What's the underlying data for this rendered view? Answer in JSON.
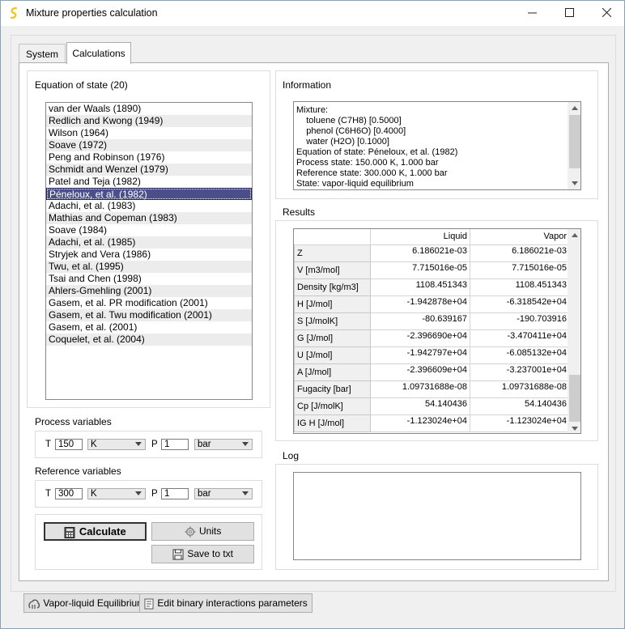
{
  "window": {
    "title": "Mixture properties calculation",
    "minimize": "—",
    "maximize": "☐",
    "close": "✕"
  },
  "tabs": [
    {
      "label": "System",
      "active": false
    },
    {
      "label": "Calculations",
      "active": true
    }
  ],
  "eos": {
    "group_label": "Equation of state (20)",
    "items": [
      "van der Waals (1890)",
      "Redlich and Kwong (1949)",
      "Wilson (1964)",
      "Soave (1972)",
      "Peng and Robinson (1976)",
      "Schmidt and Wenzel (1979)",
      "Patel and Teja (1982)",
      "Péneloux, et al. (1982)",
      "Adachi, et al. (1983)",
      "Mathias and Copeman (1983)",
      "Soave (1984)",
      "Adachi, et al. (1985)",
      "Stryjek and Vera (1986)",
      "Twu, et al. (1995)",
      "Tsai and Chen (1998)",
      "Ahlers-Gmehling (2001)",
      "Gasem, et al. PR modification (2001)",
      "Gasem, et al. Twu modification (2001)",
      "Gasem, et al. (2001)",
      "Coquelet, et al. (2004)"
    ],
    "selected_index": 7
  },
  "process": {
    "group_label": "Process variables",
    "t_label": "T",
    "t_value": "150",
    "t_unit": "K",
    "p_label": "P",
    "p_value": "1",
    "p_unit": "bar"
  },
  "reference": {
    "group_label": "Reference variables",
    "t_label": "T",
    "t_value": "300",
    "t_unit": "K",
    "p_label": "P",
    "p_value": "1",
    "p_unit": "bar"
  },
  "actions": {
    "calculate": "Calculate",
    "units": "Units",
    "save": "Save to txt"
  },
  "information": {
    "group_label": "Information",
    "lines": [
      "Mixture:",
      "    toluene (C7H8) [0.5000]",
      "    phenol (C6H6O) [0.4000]",
      "    water (H2O) [0.1000]",
      "Equation of state: Péneloux, et al. (1982)",
      "Process state: 150.000 K, 1.000 bar",
      "Reference state: 300.000 K, 1.000 bar",
      "State: vapor-liquid equilibrium"
    ]
  },
  "results": {
    "group_label": "Results",
    "columns": [
      "Liquid",
      "Vapor"
    ],
    "rows": [
      {
        "name": "Z",
        "liquid": "6.186021e-03",
        "vapor": "6.186021e-03"
      },
      {
        "name": "V [m3/mol]",
        "liquid": "7.715016e-05",
        "vapor": "7.715016e-05"
      },
      {
        "name": "Density [kg/m3]",
        "liquid": "1108.451343",
        "vapor": "1108.451343"
      },
      {
        "name": "H [J/mol]",
        "liquid": "-1.942878e+04",
        "vapor": "-6.318542e+04"
      },
      {
        "name": "S [J/molK]",
        "liquid": "-80.639167",
        "vapor": "-190.703916"
      },
      {
        "name": "G [J/mol]",
        "liquid": "-2.396690e+04",
        "vapor": "-3.470411e+04"
      },
      {
        "name": "U [J/mol]",
        "liquid": "-1.942797e+04",
        "vapor": "-6.085132e+04"
      },
      {
        "name": "A [J/mol]",
        "liquid": "-2.396609e+04",
        "vapor": "-3.237001e+04"
      },
      {
        "name": "Fugacity [bar]",
        "liquid": "1.09731688e-08",
        "vapor": "1.09731688e-08"
      },
      {
        "name": "Cp [J/molK]",
        "liquid": "54.140436",
        "vapor": "54.140436"
      },
      {
        "name": "IG H [J/mol]",
        "liquid": "-1.123024e+04",
        "vapor": "-1.123024e+04"
      }
    ]
  },
  "log": {
    "group_label": "Log"
  },
  "bottom": {
    "vle_button": "Vapor-liquid Equilibrium",
    "edit_button": "Edit binary interactions parameters"
  },
  "colors": {
    "selection": "#4a4f8a",
    "title_icon": "#f0c419"
  }
}
